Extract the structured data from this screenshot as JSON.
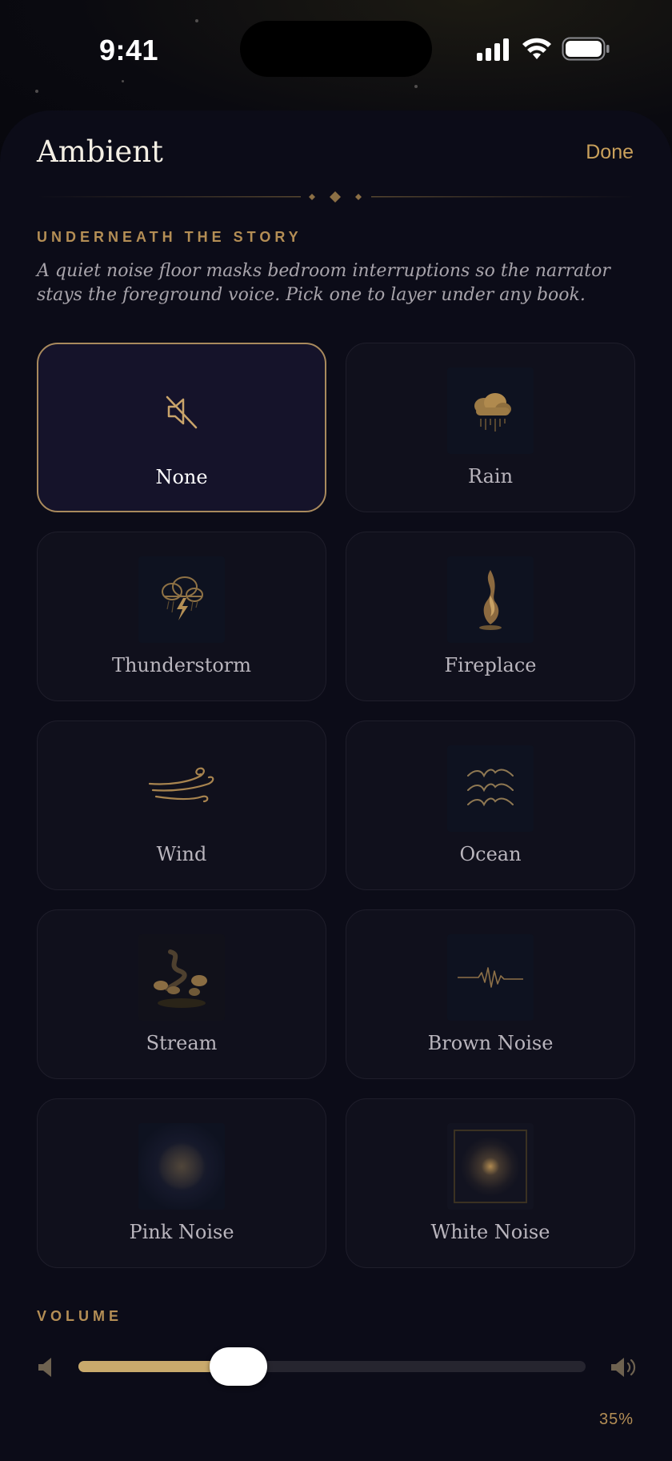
{
  "status_bar": {
    "time": "9:41"
  },
  "sheet": {
    "title": "Ambient",
    "done_label": "Done",
    "eyebrow": "UNDERNEATH THE STORY",
    "intro": "A quiet noise floor masks bedroom interruptions so the narrator stays the foreground voice. Pick one to layer under any book."
  },
  "sounds": [
    {
      "label": "None",
      "icon": "mute-icon",
      "selected": true
    },
    {
      "label": "Rain",
      "icon": "rain-cloud-icon",
      "selected": false
    },
    {
      "label": "Thunderstorm",
      "icon": "thunderstorm-icon",
      "selected": false
    },
    {
      "label": "Fireplace",
      "icon": "flame-icon",
      "selected": false
    },
    {
      "label": "Wind",
      "icon": "wind-icon",
      "selected": false
    },
    {
      "label": "Ocean",
      "icon": "waves-icon",
      "selected": false
    },
    {
      "label": "Stream",
      "icon": "stream-icon",
      "selected": false
    },
    {
      "label": "Brown Noise",
      "icon": "waveform-icon",
      "selected": false
    },
    {
      "label": "Pink Noise",
      "icon": "pink-noise-icon",
      "selected": false
    },
    {
      "label": "White Noise",
      "icon": "white-noise-icon",
      "selected": false
    }
  ],
  "volume": {
    "label": "VOLUME",
    "percent_label": "35%",
    "fraction": 0.315
  },
  "colors": {
    "accent_gold": "#c9a05b",
    "sheet_bg": "#0c0c18",
    "selected_border": "#a98a5d"
  }
}
